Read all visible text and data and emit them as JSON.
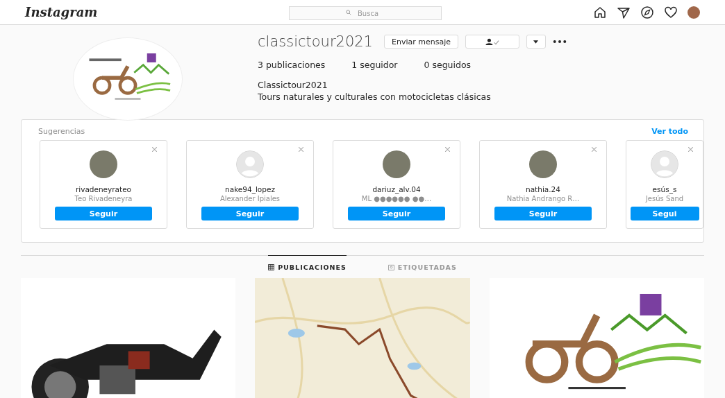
{
  "header": {
    "logo": "Instagram",
    "search": {
      "placeholder": "Busca"
    }
  },
  "profile": {
    "username": "classictour2021",
    "message_button": "Enviar mensaje",
    "stats": [
      "3 publicaciones",
      "1 seguidor",
      "0 seguidos"
    ],
    "full_name": "Classictour2021",
    "bio": "Tours naturales y culturales con motocicletas clásicas"
  },
  "suggestions": {
    "title": "Sugerencias",
    "see_all": "Ver todo",
    "cards": [
      {
        "username": "rivadeneyrateo",
        "name": "Teo Rivadeneyra",
        "button": "Seguir",
        "kind": "photo"
      },
      {
        "username": "nake94_lopez",
        "name": "Alexander Ipiales",
        "button": "Seguir",
        "kind": "default"
      },
      {
        "username": "dariuz_alv.04",
        "name": "ML ●●●●●● ●●…",
        "button": "Seguir",
        "kind": "photo"
      },
      {
        "username": "nathia.24",
        "name": "Nathia Andrango R…",
        "button": "Seguir",
        "kind": "photo"
      },
      {
        "username": "esús_s",
        "name": "Jesús Sand",
        "button": "Segui",
        "kind": "default"
      }
    ]
  },
  "tabs": [
    {
      "label": "PUBLICACIONES",
      "selected": true
    },
    {
      "label": "ETIQUETADAS",
      "selected": false
    }
  ],
  "posts": [
    {
      "kind": "photo"
    },
    {
      "kind": "map"
    },
    {
      "kind": "logo"
    }
  ]
}
